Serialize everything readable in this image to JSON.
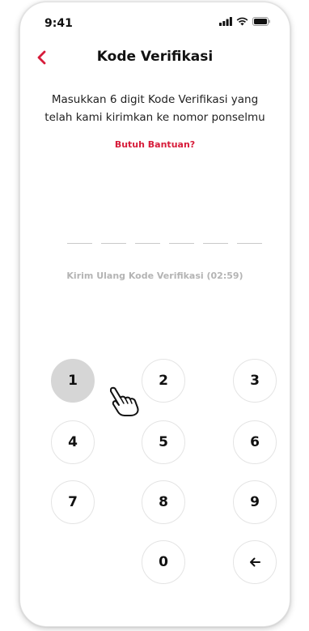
{
  "status_bar": {
    "time": "9:41",
    "signal_icon": "signal-icon",
    "wifi_icon": "wifi-icon",
    "battery_icon": "battery-icon"
  },
  "header": {
    "back_icon": "chevron-left-icon",
    "title": "Kode Verifikasi"
  },
  "instruction": "Masukkan 6 digit Kode Verifikasi yang telah kami kirimkan ke nomor ponselmu",
  "help_link": "Butuh Bantuan?",
  "otp": {
    "length": 6,
    "value": ""
  },
  "resend": "Kirim Ulang Kode Verifikasi (02:59)",
  "keypad": {
    "keys": [
      "1",
      "2",
      "3",
      "4",
      "5",
      "6",
      "7",
      "8",
      "9",
      "0"
    ],
    "backspace_icon": "backspace-arrow-icon",
    "pressed_key": "1"
  },
  "colors": {
    "accent": "#d71c3a",
    "text": "#111111",
    "muted": "#b4b4b4",
    "pressed": "#d6d6d6"
  }
}
